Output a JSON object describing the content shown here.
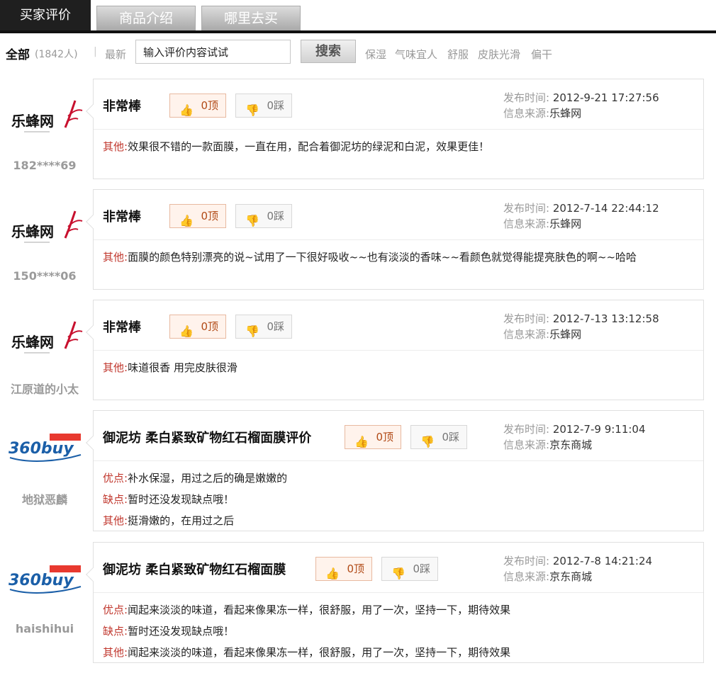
{
  "tabs": [
    {
      "label": "买家评价"
    },
    {
      "label": "商品介绍"
    },
    {
      "label": "哪里去买"
    }
  ],
  "filter": {
    "all_label": "全部",
    "count": "(1842人)",
    "separator": "|",
    "latest_label": "最新",
    "search_value": "输入评价内容试试",
    "search_button": "搜索",
    "tags": [
      "保湿",
      "气味宜人",
      "舒服",
      "皮肤光滑",
      "偏干"
    ]
  },
  "labels": {
    "time": "发布时间:",
    "source": "信息来源:",
    "pros": "优点:",
    "cons": "缺点:",
    "other": "其他:"
  },
  "reviews": [
    {
      "logo": "乐蜂网",
      "user": "182****69",
      "title": "非常棒",
      "up": "0顶",
      "down": "0踩",
      "time": "2012-9-21 17:27:56",
      "source": "乐蜂网",
      "other": "效果很不错的一款面膜，一直在用，配合着御泥坊的绿泥和白泥，效果更佳！"
    },
    {
      "logo": "乐蜂网",
      "user": "150****06",
      "title": "非常棒",
      "up": "0顶",
      "down": "0踩",
      "time": "2012-7-14 22:44:12",
      "source": "乐蜂网",
      "other": "面膜的颜色特别漂亮的说~试用了一下很好吸收~~也有淡淡的香味~~看颜色就觉得能提亮肤色的啊~~哈哈"
    },
    {
      "logo": "乐蜂网",
      "user": "江原道的小太",
      "title": "非常棒",
      "up": "0顶",
      "down": "0踩",
      "time": "2012-7-13 13:12:58",
      "source": "乐蜂网",
      "other": "味道很香 用完皮肤很滑"
    },
    {
      "logo": "360buy",
      "user": "地狱恶麟",
      "title": "御泥坊 柔白紧致矿物红石榴面膜评价",
      "up": "0顶",
      "down": "0踩",
      "time": "2012-7-9 9:11:04",
      "source": "京东商城",
      "pros": "补水保湿，用过之后的确是嫩嫩的",
      "cons": "暂时还没发现缺点哦！",
      "other": "挺滑嫩的，在用过之后"
    },
    {
      "logo": "360buy",
      "user": "haishihui",
      "title": "御泥坊 柔白紧致矿物红石榴面膜",
      "up": "0顶",
      "down": "0踩",
      "time": "2012-7-8 14:21:24",
      "source": "京东商城",
      "pros": "闻起来淡淡的味道，看起来像果冻一样，很舒服，用了一次，坚持一下，期待效果",
      "cons": "暂时还没发现缺点哦！",
      "other": "闻起来淡淡的味道，看起来像果冻一样，很舒服，用了一次，坚持一下，期待效果"
    }
  ],
  "colors": {
    "label_red": "#c0362c",
    "tab_active": "#1f1f1f",
    "muted": "#999999"
  }
}
